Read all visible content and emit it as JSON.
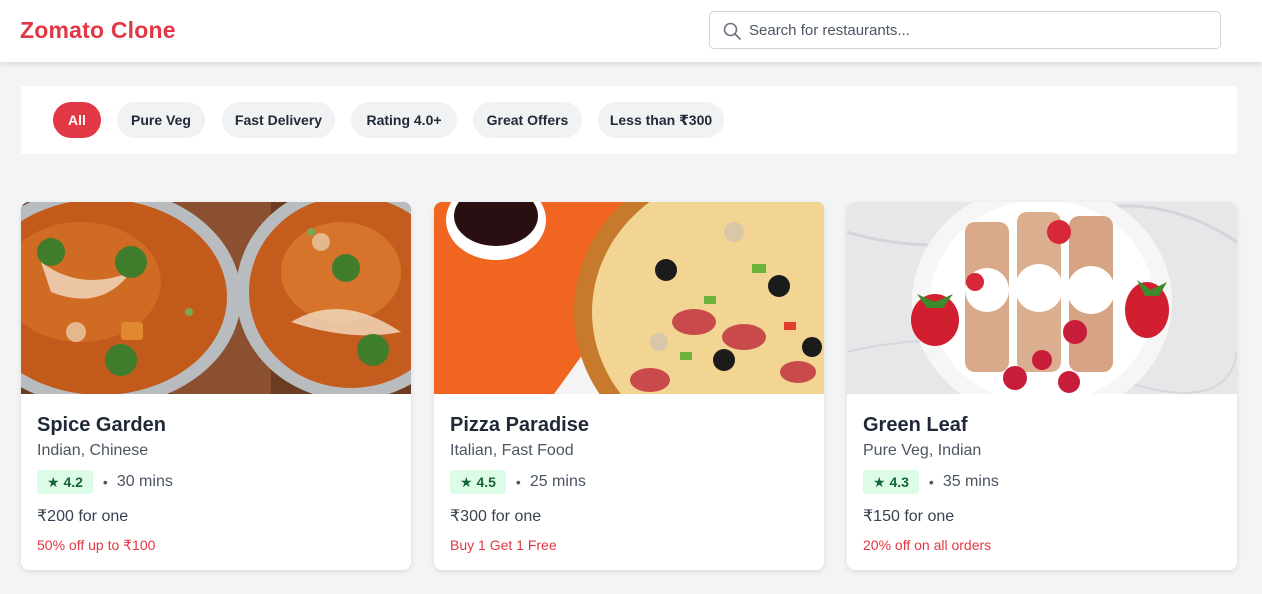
{
  "header": {
    "logo": "Zomato Clone",
    "search_placeholder": "Search for restaurants..."
  },
  "filters": [
    {
      "label": "All",
      "active": true
    },
    {
      "label": "Pure Veg",
      "active": false
    },
    {
      "label": "Fast Delivery",
      "active": false
    },
    {
      "label": "Rating 4.0+",
      "active": false
    },
    {
      "label": "Great Offers",
      "active": false
    },
    {
      "label": "Less than ₹300",
      "active": false
    }
  ],
  "restaurants": [
    {
      "name": "Spice Garden",
      "cuisine": "Indian, Chinese",
      "rating": "★ 4.2",
      "dot": "•",
      "time": "30 mins",
      "price": "₹200 for one",
      "offer": "50% off up to ₹100"
    },
    {
      "name": "Pizza Paradise",
      "cuisine": "Italian, Fast Food",
      "rating": "★ 4.5",
      "dot": "•",
      "time": "25 mins",
      "price": "₹300 for one",
      "offer": "Buy 1 Get 1 Free"
    },
    {
      "name": "Green Leaf",
      "cuisine": "Pure Veg, Indian",
      "rating": "★ 4.3",
      "dot": "•",
      "time": "35 mins",
      "price": "₹150 for one",
      "offer": "20% off on all orders"
    }
  ],
  "colors": {
    "brand": "#e23744",
    "rating_bg": "#dcfce7",
    "rating_text": "#166534"
  },
  "icons": {
    "search": "search-icon"
  }
}
